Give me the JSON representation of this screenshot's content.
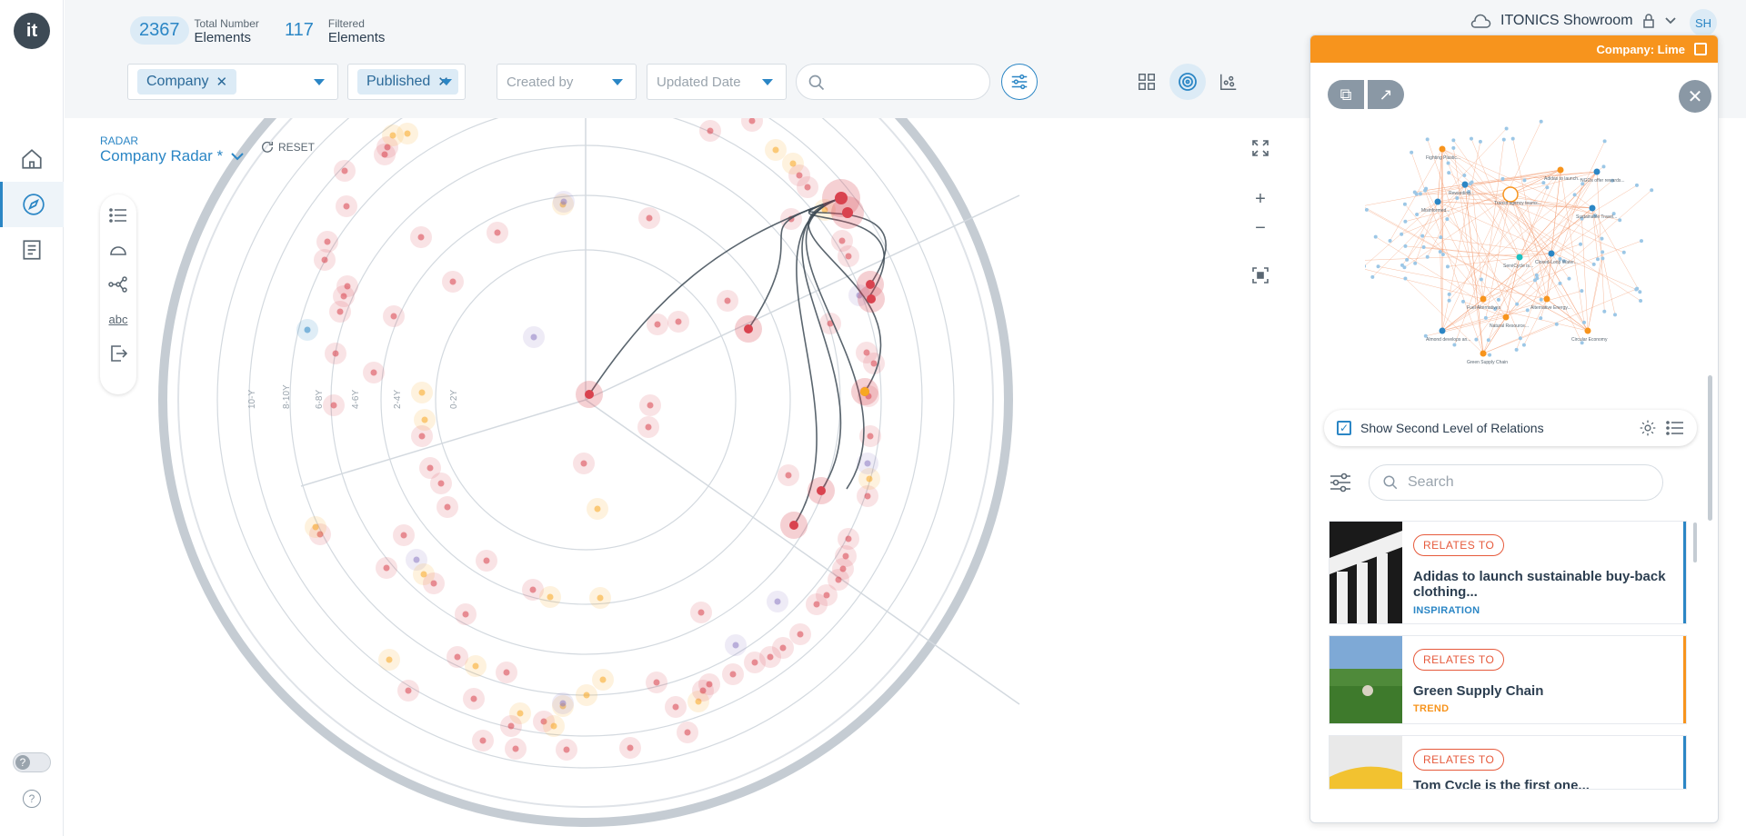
{
  "sidebar": {
    "logo": "it",
    "items": [
      {
        "name": "home",
        "icon": "home-icon"
      },
      {
        "name": "radar",
        "icon": "compass-icon",
        "active": true
      },
      {
        "name": "documents",
        "icon": "document-icon"
      }
    ],
    "help_toggle": "?",
    "help": "?"
  },
  "header": {
    "total": {
      "value": "2367",
      "label1": "Total Number",
      "label2": "Elements"
    },
    "filtered": {
      "value": "117",
      "label1": "Filtered",
      "label2": "Elements"
    },
    "filters": [
      {
        "chip": "Company"
      },
      {
        "chip": "Published"
      },
      {
        "placeholder": "Created by"
      },
      {
        "placeholder": "Updated Date"
      }
    ],
    "workspace": "ITONICS Showroom",
    "avatar": "SH"
  },
  "radar": {
    "label_small": "RADAR",
    "label_big": "Company Radar *",
    "reset": "RESET",
    "toolbar_text": "abc",
    "ring_labels": [
      "10-Y",
      "8-10Y",
      "6-8Y",
      "4-6Y",
      "2-4Y",
      "0-2Y"
    ],
    "colors": {
      "red": "#d9434f",
      "orange": "#f7a823",
      "blue": "#2b86c5",
      "purple": "#8e7cc3",
      "ring": "#c5ccd3",
      "link": "#3d4a55"
    }
  },
  "panel": {
    "header": "Company: Lime",
    "accent": "#f7941d",
    "network_labels": [
      "Fighting Plastic...",
      "Transit agency teams...",
      "Rewarding...",
      "Misinformed...",
      "Adidas to launch...",
      "NGOs offer rewards...",
      "Sustainable Travel...",
      "Closed-Loop Water...",
      "ServiCycle is...",
      "Fuel Alternatives",
      "Alternative Energy...",
      "Natural Resource...",
      "Almond develops an...",
      "Circular Economy",
      "Green Supply Chain"
    ],
    "second_level": "Show Second Level of Relations",
    "search_placeholder": "Search",
    "items": [
      {
        "badge": "RELATES TO",
        "title": "Adidas to launch sustainable buy-back clothing...",
        "type": "INSPIRATION",
        "type_color": "#2b86c5"
      },
      {
        "badge": "RELATES TO",
        "title": "Green Supply Chain",
        "type": "TREND",
        "type_color": "#f7941d"
      },
      {
        "badge": "RELATES TO",
        "title": "Tom Cycle is the first one...",
        "type": "",
        "type_color": "#2b86c5"
      }
    ]
  }
}
